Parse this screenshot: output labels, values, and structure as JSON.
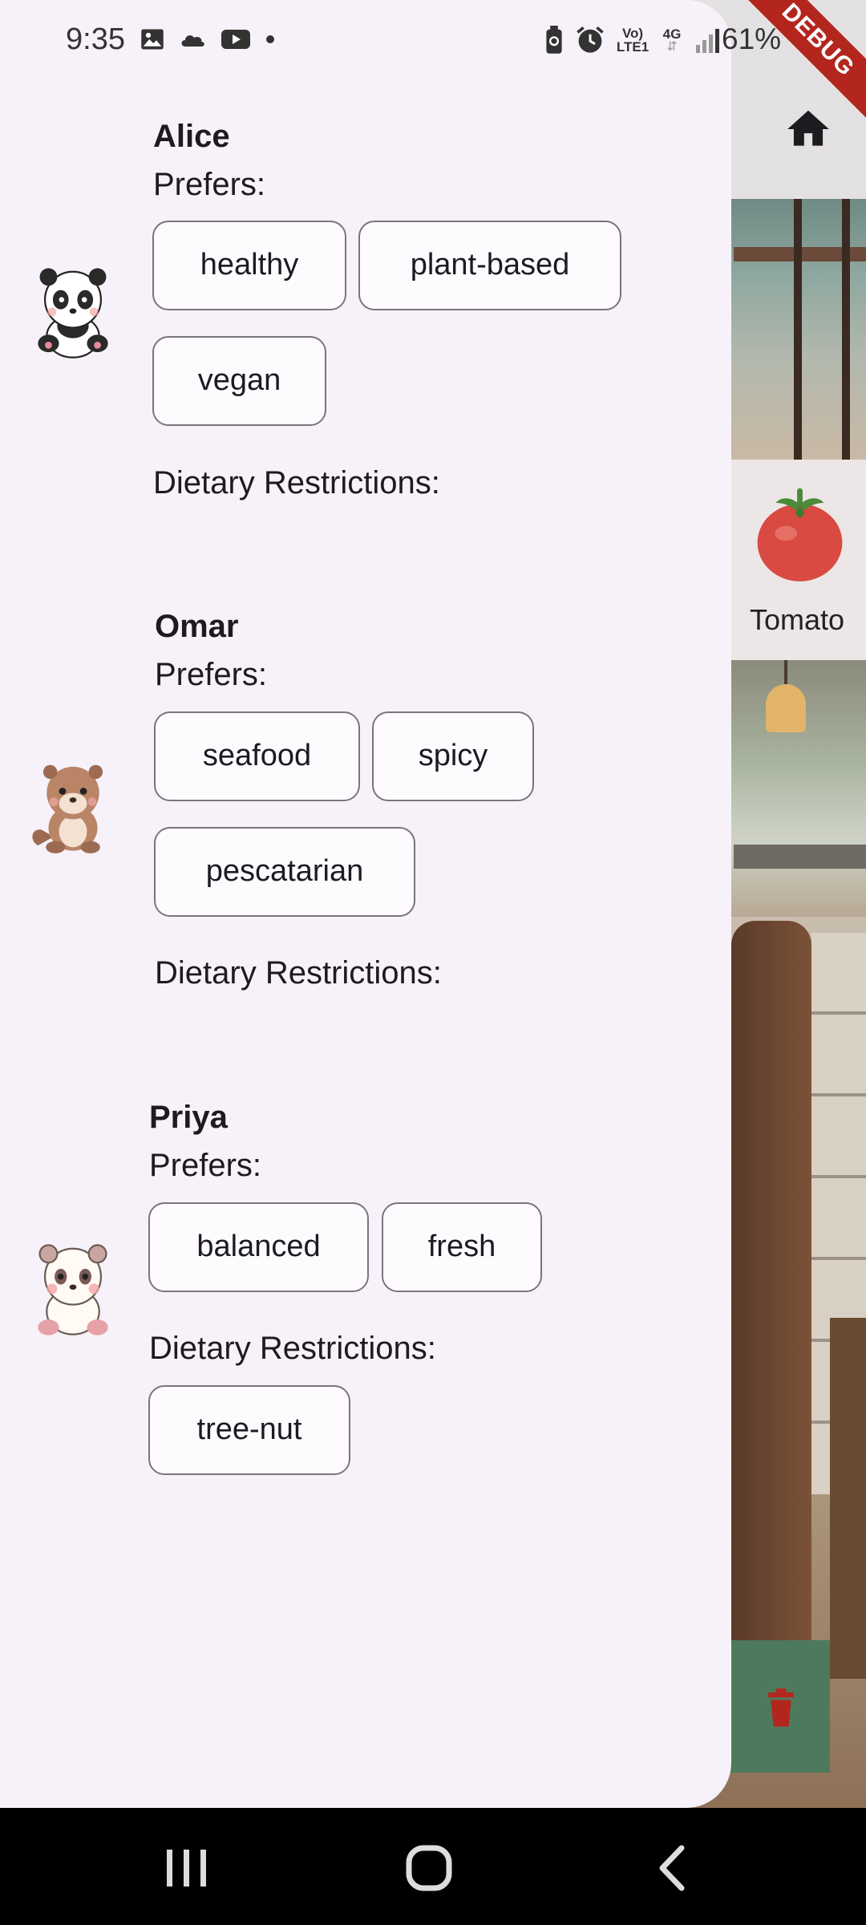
{
  "status_bar": {
    "time": "9:35",
    "battery": "61%",
    "left_icons": [
      "image-icon",
      "cloud-icon",
      "youtube-icon",
      "dot-icon"
    ],
    "right_icons": [
      "battery-saver-icon",
      "alarm-icon",
      "volte-icon",
      "4g-icon",
      "signal-icon"
    ],
    "volte_label": "Vo) LTE1",
    "network_label": "4G"
  },
  "debug_banner": "DEBUG",
  "background": {
    "home_icon": "home-icon",
    "tomato_label": "Tomato",
    "delete_icon": "trash-icon",
    "delete_color": "#4d7a5d"
  },
  "members": [
    {
      "name": "Alice",
      "avatar": "panda-avatar-icon",
      "prefers_label": "Prefers:",
      "prefers": [
        "healthy",
        "plant-based",
        "vegan"
      ],
      "restrictions_label": "Dietary Restrictions:",
      "restrictions": []
    },
    {
      "name": "Omar",
      "avatar": "otter-avatar-icon",
      "prefers_label": "Prefers:",
      "prefers": [
        "seafood",
        "spicy",
        "pescatarian"
      ],
      "restrictions_label": "Dietary Restrictions:",
      "restrictions": []
    },
    {
      "name": "Priya",
      "avatar": "bear-avatar-icon",
      "prefers_label": "Prefers:",
      "prefers": [
        "balanced",
        "fresh"
      ],
      "restrictions_label": "Dietary Restrictions:",
      "restrictions": [
        "tree-nut"
      ]
    }
  ],
  "nav_bar": {
    "buttons": [
      "recent-apps-icon",
      "home-circle-icon",
      "back-icon"
    ]
  },
  "colors": {
    "drawer_bg": "#f7f2f9",
    "chip_border": "#79747e",
    "debug_red": "#b3261e"
  }
}
